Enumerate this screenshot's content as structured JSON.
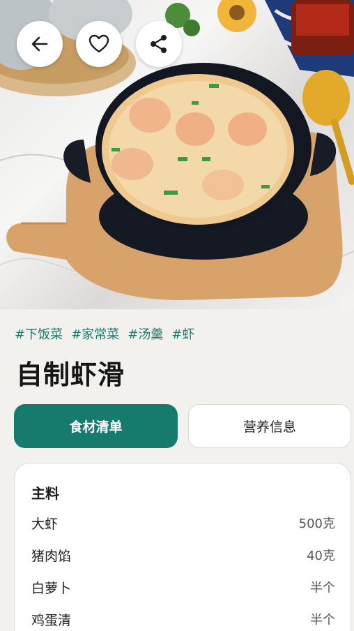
{
  "header": {
    "back_icon": "arrow-left-icon",
    "favorite_icon": "heart-outline-icon",
    "share_icon": "share-icon"
  },
  "tags": [
    "#下饭菜",
    "#家常菜",
    "#汤羹",
    "#虾"
  ],
  "recipe": {
    "title": "自制虾滑"
  },
  "tabs": [
    {
      "label": "食材清单",
      "active": true
    },
    {
      "label": "营养信息",
      "active": false
    }
  ],
  "ingredients": {
    "section_title": "主料",
    "items": [
      {
        "name": "大虾",
        "amount": "500克"
      },
      {
        "name": "猪肉馅",
        "amount": "40克"
      },
      {
        "name": "白萝卜",
        "amount": "半个"
      },
      {
        "name": "鸡蛋清",
        "amount": "半个"
      }
    ]
  },
  "colors": {
    "accent": "#167a6d",
    "tag": "#1a7a6c",
    "background": "#f2f1ee"
  }
}
